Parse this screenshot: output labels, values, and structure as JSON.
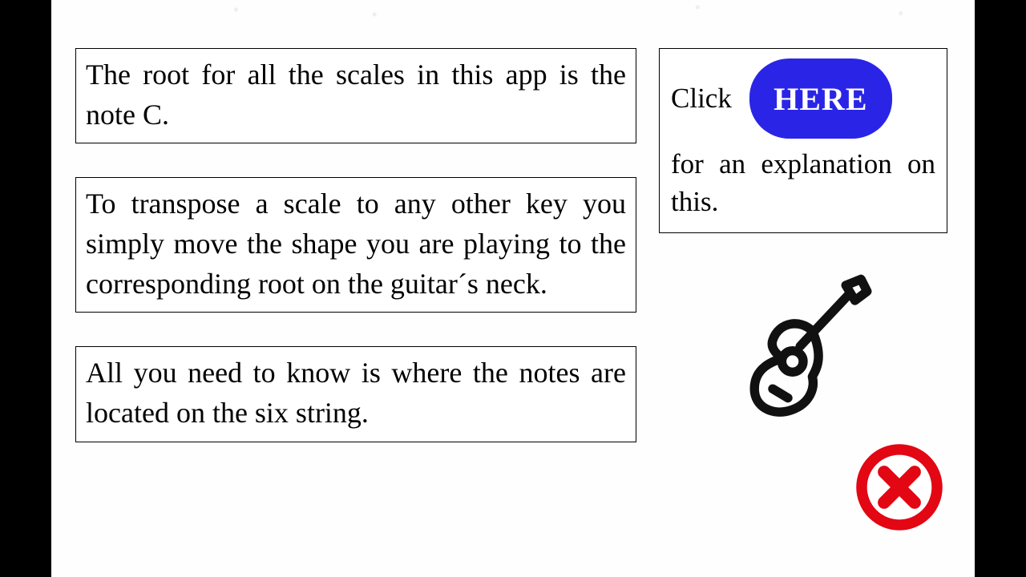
{
  "left": {
    "box1": "The root for all the scales in this app is the note C.",
    "box2": "To transpose a scale to any other key you simply move the shape you are playing to the corresponding root on the guitar´s neck.",
    "box3": "All you need to know is where the notes are located on the six string."
  },
  "right": {
    "click_word": "Click",
    "here_label": "HERE",
    "rest": "for an explanation on this."
  },
  "colors": {
    "button": "#2a25e6",
    "close": "#e30613"
  }
}
